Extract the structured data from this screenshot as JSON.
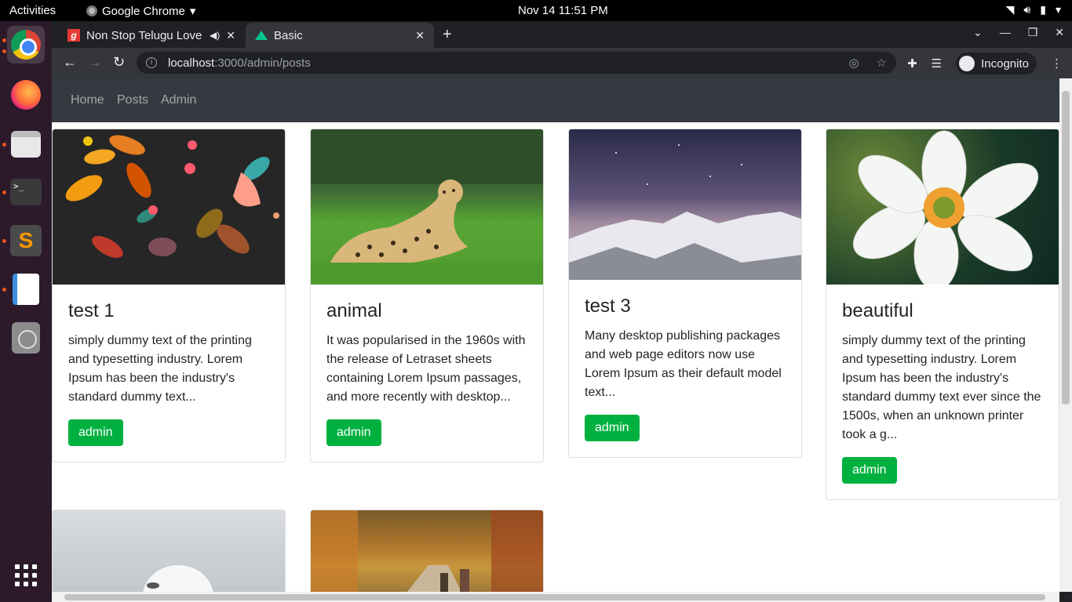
{
  "topbar": {
    "activities": "Activities",
    "app_name": "Google Chrome",
    "clock": "Nov 14  11:51 PM"
  },
  "tabs": [
    {
      "title": "Non Stop Telugu Love",
      "favicon": "gaana-icon",
      "audio": true
    },
    {
      "title": "Basic",
      "favicon": "nuxt-icon",
      "active": true
    }
  ],
  "omnibox": {
    "host": "localhost",
    "path": ":3000/admin/posts"
  },
  "profile": {
    "label": "Incognito"
  },
  "navbar": {
    "links": [
      "Home",
      "Posts",
      "Admin"
    ]
  },
  "posts": [
    {
      "title": "test 1",
      "text": "simply dummy text of the printing and typesetting industry. Lorem Ipsum has been the industry's standard dummy text...",
      "author": "admin",
      "image": "leaves-illustration"
    },
    {
      "title": "animal",
      "text": "It was popularised in the 1960s with the release of Letraset sheets containing Lorem Ipsum passages, and more recently with desktop...",
      "author": "admin",
      "image": "cheetah-photo"
    },
    {
      "title": "test 3",
      "text": "Many desktop publishing packages and web page editors now use Lorem Ipsum as their default model text...",
      "author": "admin",
      "image": "snowy-mountain-photo"
    },
    {
      "title": "beautiful",
      "text": "simply dummy text of the printing and typesetting industry. Lorem Ipsum has been the industry's standard dummy text ever since the 1500s, when an unknown printer took a g...",
      "author": "admin",
      "image": "white-flower-photo"
    },
    {
      "image": "white-dog-photo"
    },
    {
      "image": "autumn-forest-photo"
    }
  ],
  "colors": {
    "navbar": "#343a40",
    "button": "#00b140",
    "page_bg": "#ffffff"
  }
}
